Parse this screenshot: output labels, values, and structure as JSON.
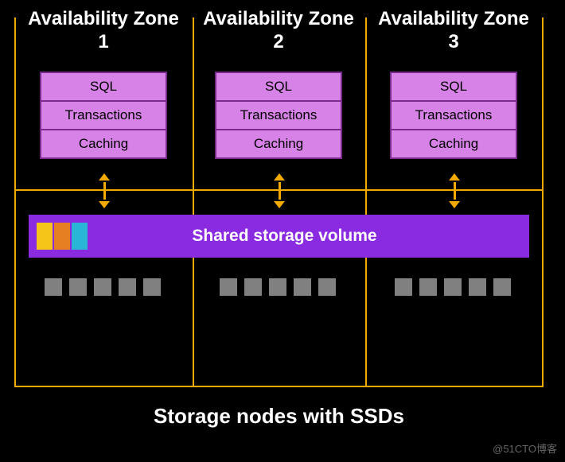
{
  "zones": [
    {
      "title": "Availability Zone 1",
      "layers": [
        "SQL",
        "Transactions",
        "Caching"
      ]
    },
    {
      "title": "Availability Zone 2",
      "layers": [
        "SQL",
        "Transactions",
        "Caching"
      ]
    },
    {
      "title": "Availability Zone 3",
      "layers": [
        "SQL",
        "Transactions",
        "Caching"
      ]
    }
  ],
  "storage_volume": {
    "label": "Shared storage volume",
    "swatch_colors": [
      "#f5c518",
      "#e67e22",
      "#29b6d6"
    ]
  },
  "nodes": {
    "colors": {
      "y": "#f5c518",
      "o": "#e67e22",
      "c": "#29b6d6",
      "g": "#808080"
    },
    "groups": [
      {
        "rows": [
          [
            "y",
            "o",
            "c",
            "g",
            "g"
          ],
          [
            "g",
            "y",
            "g",
            "g",
            "c"
          ],
          [
            "g",
            "g",
            "g",
            "g",
            "g"
          ]
        ]
      },
      {
        "rows": [
          [
            "c",
            "y",
            "g",
            "o",
            "o"
          ],
          [
            "g",
            "g",
            "g",
            "g",
            "g"
          ],
          [
            "g",
            "g",
            "g",
            "g",
            "g"
          ]
        ]
      },
      {
        "rows": [
          [
            "o",
            "o",
            "y",
            "y",
            "g"
          ],
          [
            "g",
            "g",
            "g",
            "c",
            "g"
          ],
          [
            "g",
            "g",
            "g",
            "g",
            "g"
          ]
        ]
      }
    ]
  },
  "caption": "Storage nodes with SSDs",
  "watermark": "@51CTO博客"
}
